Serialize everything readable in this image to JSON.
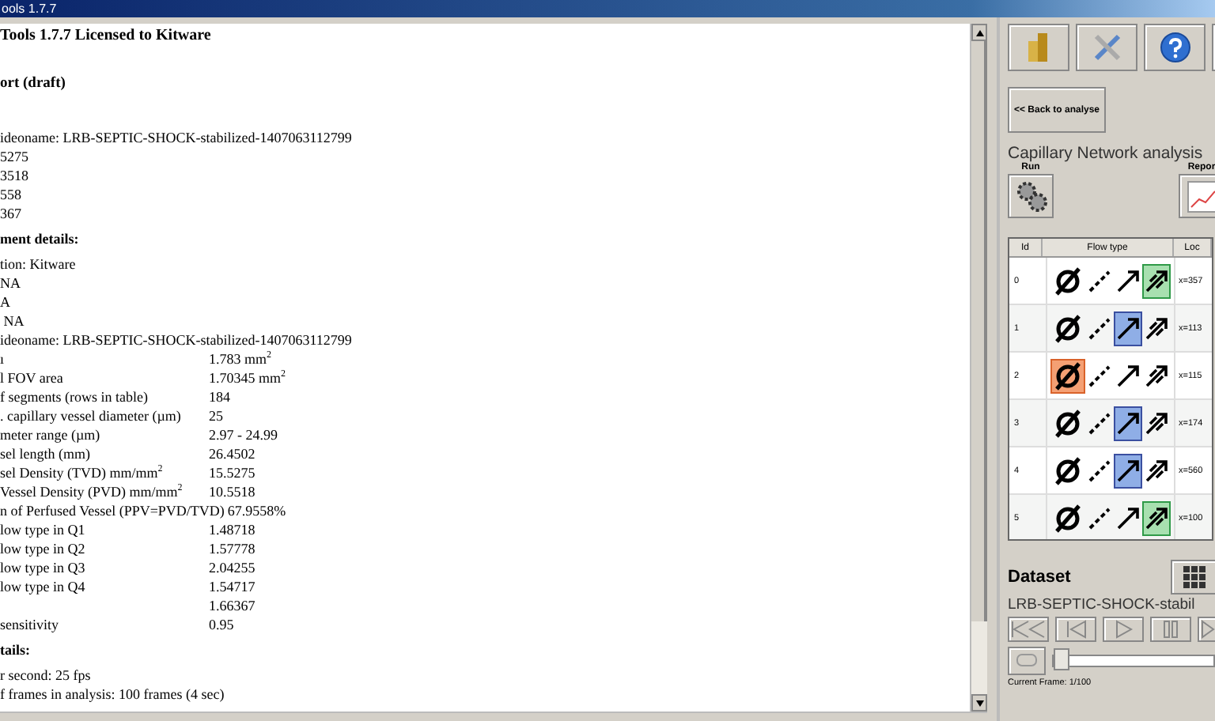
{
  "window": {
    "title": "ools 1.7.7"
  },
  "report": {
    "title": "Tools 1.7.7 Licensed to Kitware",
    "subtitle": "ort (draft)",
    "blocks": [
      {
        "kind": "gap"
      },
      {
        "kind": "line",
        "text": "ideoname: LRB-SEPTIC-SHOCK-stabilized-1407063112799"
      },
      {
        "kind": "line",
        "text": "5275"
      },
      {
        "kind": "line",
        "text": "3518"
      },
      {
        "kind": "line",
        "text": "558"
      },
      {
        "kind": "line",
        "text": "367"
      },
      {
        "kind": "heading",
        "text": "ment details:"
      },
      {
        "kind": "line",
        "text": "tion: Kitware"
      },
      {
        "kind": "line",
        "text": "NA"
      },
      {
        "kind": "line",
        "text": "A"
      },
      {
        "kind": "line",
        "text": " NA"
      },
      {
        "kind": "line",
        "text": "ideoname: LRB-SEPTIC-SHOCK-stabilized-1407063112799"
      },
      {
        "kind": "pair",
        "label": "ı",
        "value": "1.783 mm$^{2}$"
      },
      {
        "kind": "pair",
        "label": "l FOV area",
        "value": "1.70345 mm$^{2}$"
      },
      {
        "kind": "pair",
        "label": "f segments (rows in table)",
        "value": "184"
      },
      {
        "kind": "pair",
        "label": ". capillary vessel diameter (µm)",
        "value": "25"
      },
      {
        "kind": "pair",
        "label": "meter range (µm)",
        "value": "2.97 - 24.99"
      },
      {
        "kind": "pair",
        "label": "sel length (mm)",
        "value": "26.4502"
      },
      {
        "kind": "pair",
        "label": "sel Density (TVD) mm/mm$^{2}$",
        "value": "15.5275"
      },
      {
        "kind": "pair",
        "label": "Vessel Density (PVD) mm/mm$^{2}$",
        "value": "10.5518"
      },
      {
        "kind": "pair",
        "label": "n of Perfused Vessel (PPV=PVD/TVD)",
        "value": "67.9558%"
      },
      {
        "kind": "pair",
        "label": "low type in Q1",
        "value": "1.48718"
      },
      {
        "kind": "pair",
        "label": "low type in Q2",
        "value": "1.57778"
      },
      {
        "kind": "pair",
        "label": "low type in Q3",
        "value": "2.04255"
      },
      {
        "kind": "pair",
        "label": "low type in Q4",
        "value": "1.54717"
      },
      {
        "kind": "pair",
        "value": "1.66367"
      },
      {
        "kind": "pair",
        "label": " sensitivity",
        "value": "0.95"
      },
      {
        "kind": "heading",
        "text": "tails:"
      },
      {
        "kind": "line",
        "text": "r second: 25 fps"
      },
      {
        "kind": "line",
        "text": "f frames in analysis: 100 frames (4 sec)"
      }
    ]
  },
  "panel": {
    "back_button": "<< Back to analyse",
    "title": "Capillary Network analysis",
    "run_label": "Run",
    "report_label": "Repor",
    "table": {
      "columns": [
        "Id",
        "Flow type",
        "Loc"
      ],
      "rows": [
        {
          "id": "0",
          "flow": [
            {
              "selected": false
            },
            {
              "selected": false
            },
            {
              "selected": false
            },
            {
              "selected": true
            }
          ],
          "location": "x=357"
        },
        {
          "id": "1",
          "flow": [
            {
              "selected": false
            },
            {
              "selected": false
            },
            {
              "selected": true
            },
            {
              "selected": false
            }
          ],
          "location": "x=113"
        },
        {
          "id": "2",
          "flow": [
            {
              "selected": true
            },
            {
              "selected": false
            },
            {
              "selected": false
            },
            {
              "selected": false
            }
          ],
          "location": "x=115"
        },
        {
          "id": "3",
          "flow": [
            {
              "selected": false
            },
            {
              "selected": false
            },
            {
              "selected": true
            },
            {
              "selected": false
            }
          ],
          "location": "x=174"
        },
        {
          "id": "4",
          "flow": [
            {
              "selected": false
            },
            {
              "selected": false
            },
            {
              "selected": true
            },
            {
              "selected": false
            }
          ],
          "location": "x=560"
        },
        {
          "id": "5",
          "flow": [
            {
              "selected": false
            },
            {
              "selected": false
            },
            {
              "selected": false
            },
            {
              "selected": true
            }
          ],
          "location": "x=100"
        }
      ]
    },
    "dataset": {
      "title": "Dataset",
      "name": "LRB-SEPTIC-SHOCK-stabil",
      "frame_slider": {
        "level": 0
      },
      "current_frame": "Current Frame: 1/100"
    }
  }
}
